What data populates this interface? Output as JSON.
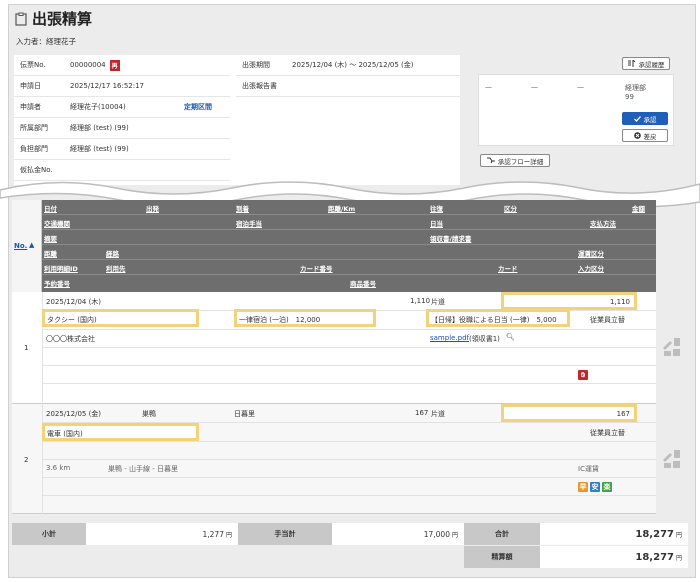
{
  "header": {
    "title": "出張精算",
    "inputter": "入力者：経理花子"
  },
  "info": {
    "slip_no_label": "伝票No.",
    "slip_no": "00000004",
    "slip_badge": "再",
    "apply_date_label": "申請日",
    "apply_date": "2025/12/17 16:52:17",
    "applicant_label": "申請者",
    "applicant": "経理花子(10004)",
    "commuter_link": "定期区間",
    "dept_label": "所属部門",
    "dept": "経理部 (test) (99)",
    "charge_dept_label": "負担部門",
    "charge_dept": "経理部 (test) (99)",
    "advance_label": "仮払金No.",
    "trip_period_label": "出張期間",
    "trip_period": "2025/12/04 (木) ～ 2025/12/05 (金)",
    "trip_report_label": "出張報告書"
  },
  "approval": {
    "history_button": "承認履歴",
    "dash1": "—",
    "dash2": "—",
    "dash3": "—",
    "approver_dept": "経理部",
    "approver_code": "99",
    "approve_button": "承認",
    "reject_button": "差戻",
    "flow_button": "承認フロー詳細"
  },
  "grid_header": {
    "no_label": "No.",
    "sort_icon": "sort-up-icon",
    "r1": [
      "日付",
      "出発",
      "到着",
      "距離/Km",
      "往復",
      "区分",
      "金額"
    ],
    "r2": [
      "交通機関",
      "宿泊手当",
      "日当",
      "支払方法"
    ],
    "r3": [
      "摘要",
      "領収書/請求書"
    ],
    "r4": [
      "距離",
      "経路",
      "運賃区分"
    ],
    "r5": [
      "利用明細ID",
      "利用先",
      "カード番号",
      "カード",
      "入力区分"
    ],
    "r6": [
      "予約番号",
      "商品番号"
    ]
  },
  "rows": [
    {
      "no": "1",
      "date": "2025/12/04 (木)",
      "distance": "1,110",
      "trip_type": "片道",
      "amount": "1,110",
      "transport": "タクシー (国内)",
      "lodging": "一律宿泊 (一泊)　12,000",
      "daily": "【日帰】役職による日当 (一律)　5,000",
      "payment": "従業員立替",
      "vendor": "〇〇〇株式会社",
      "receipt_file": "sample.pdf",
      "receipt_note": "(領収書1)"
    },
    {
      "no": "2",
      "date": "2025/12/05 (金)",
      "from": "巣鴨",
      "to": "日暮里",
      "distance": "167",
      "trip_type": "片道",
      "amount": "167",
      "transport": "電車 (国内)",
      "payment": "従業員立替",
      "km": "3.6 km",
      "route": "巣鴨 - 山手線 - 日暮里",
      "fare_type": "IC運賃",
      "tag1": "早",
      "tag2": "安",
      "tag3": "楽"
    }
  ],
  "totals": {
    "subtotal_label": "小計",
    "subtotal": "1,277",
    "allowance_label": "手当計",
    "allowance": "17,000",
    "total_label": "合計",
    "total": "18,277",
    "settle_label": "精算額",
    "settle": "18,277",
    "yen": "円"
  },
  "colors": {
    "highlight": "#f2d27a",
    "header_bg": "#6e6e6e",
    "approve_blue": "#1f5fb6",
    "badge_red": "#c0272d"
  }
}
